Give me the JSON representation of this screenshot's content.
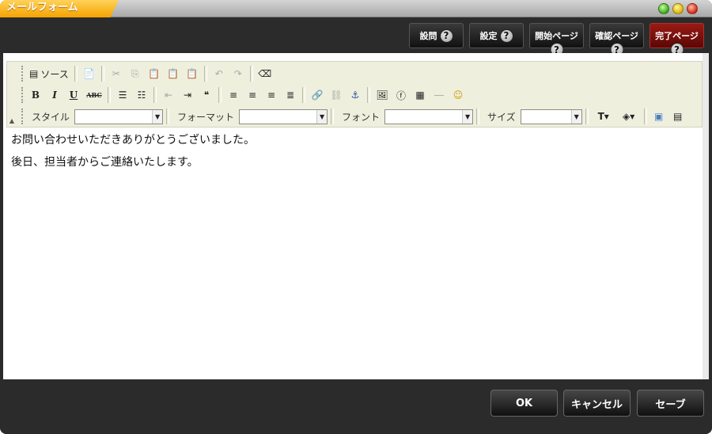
{
  "window": {
    "title": "メールフォーム"
  },
  "topbar": {
    "buttons": [
      {
        "label": "設問",
        "help": "?"
      },
      {
        "label": "設定",
        "help": "?"
      },
      {
        "label": "開始ページ",
        "help": "?"
      },
      {
        "label": "確認ページ",
        "help": "?"
      },
      {
        "label": "完了ページ",
        "help": "?",
        "active": true
      }
    ]
  },
  "toolbar": {
    "source_label": "ソース",
    "bold": "B",
    "italic": "I",
    "underline": "U",
    "strike": "ABC",
    "style_label": "スタイル",
    "format_label": "フォーマット",
    "font_label": "フォント",
    "size_label": "サイズ",
    "style_value": "",
    "format_value": "",
    "font_value": "",
    "size_value": ""
  },
  "content": {
    "lines": [
      "お問い合わせいただきありがとうございました。",
      "後日、担当者からご連絡いたします。"
    ]
  },
  "footer": {
    "ok": "OK",
    "cancel": "キャンセル",
    "save": "セーブ"
  },
  "colors": {
    "accent": "#f5a200",
    "active_button": "#7a0f0b",
    "toolbar_bg": "#efefde"
  }
}
